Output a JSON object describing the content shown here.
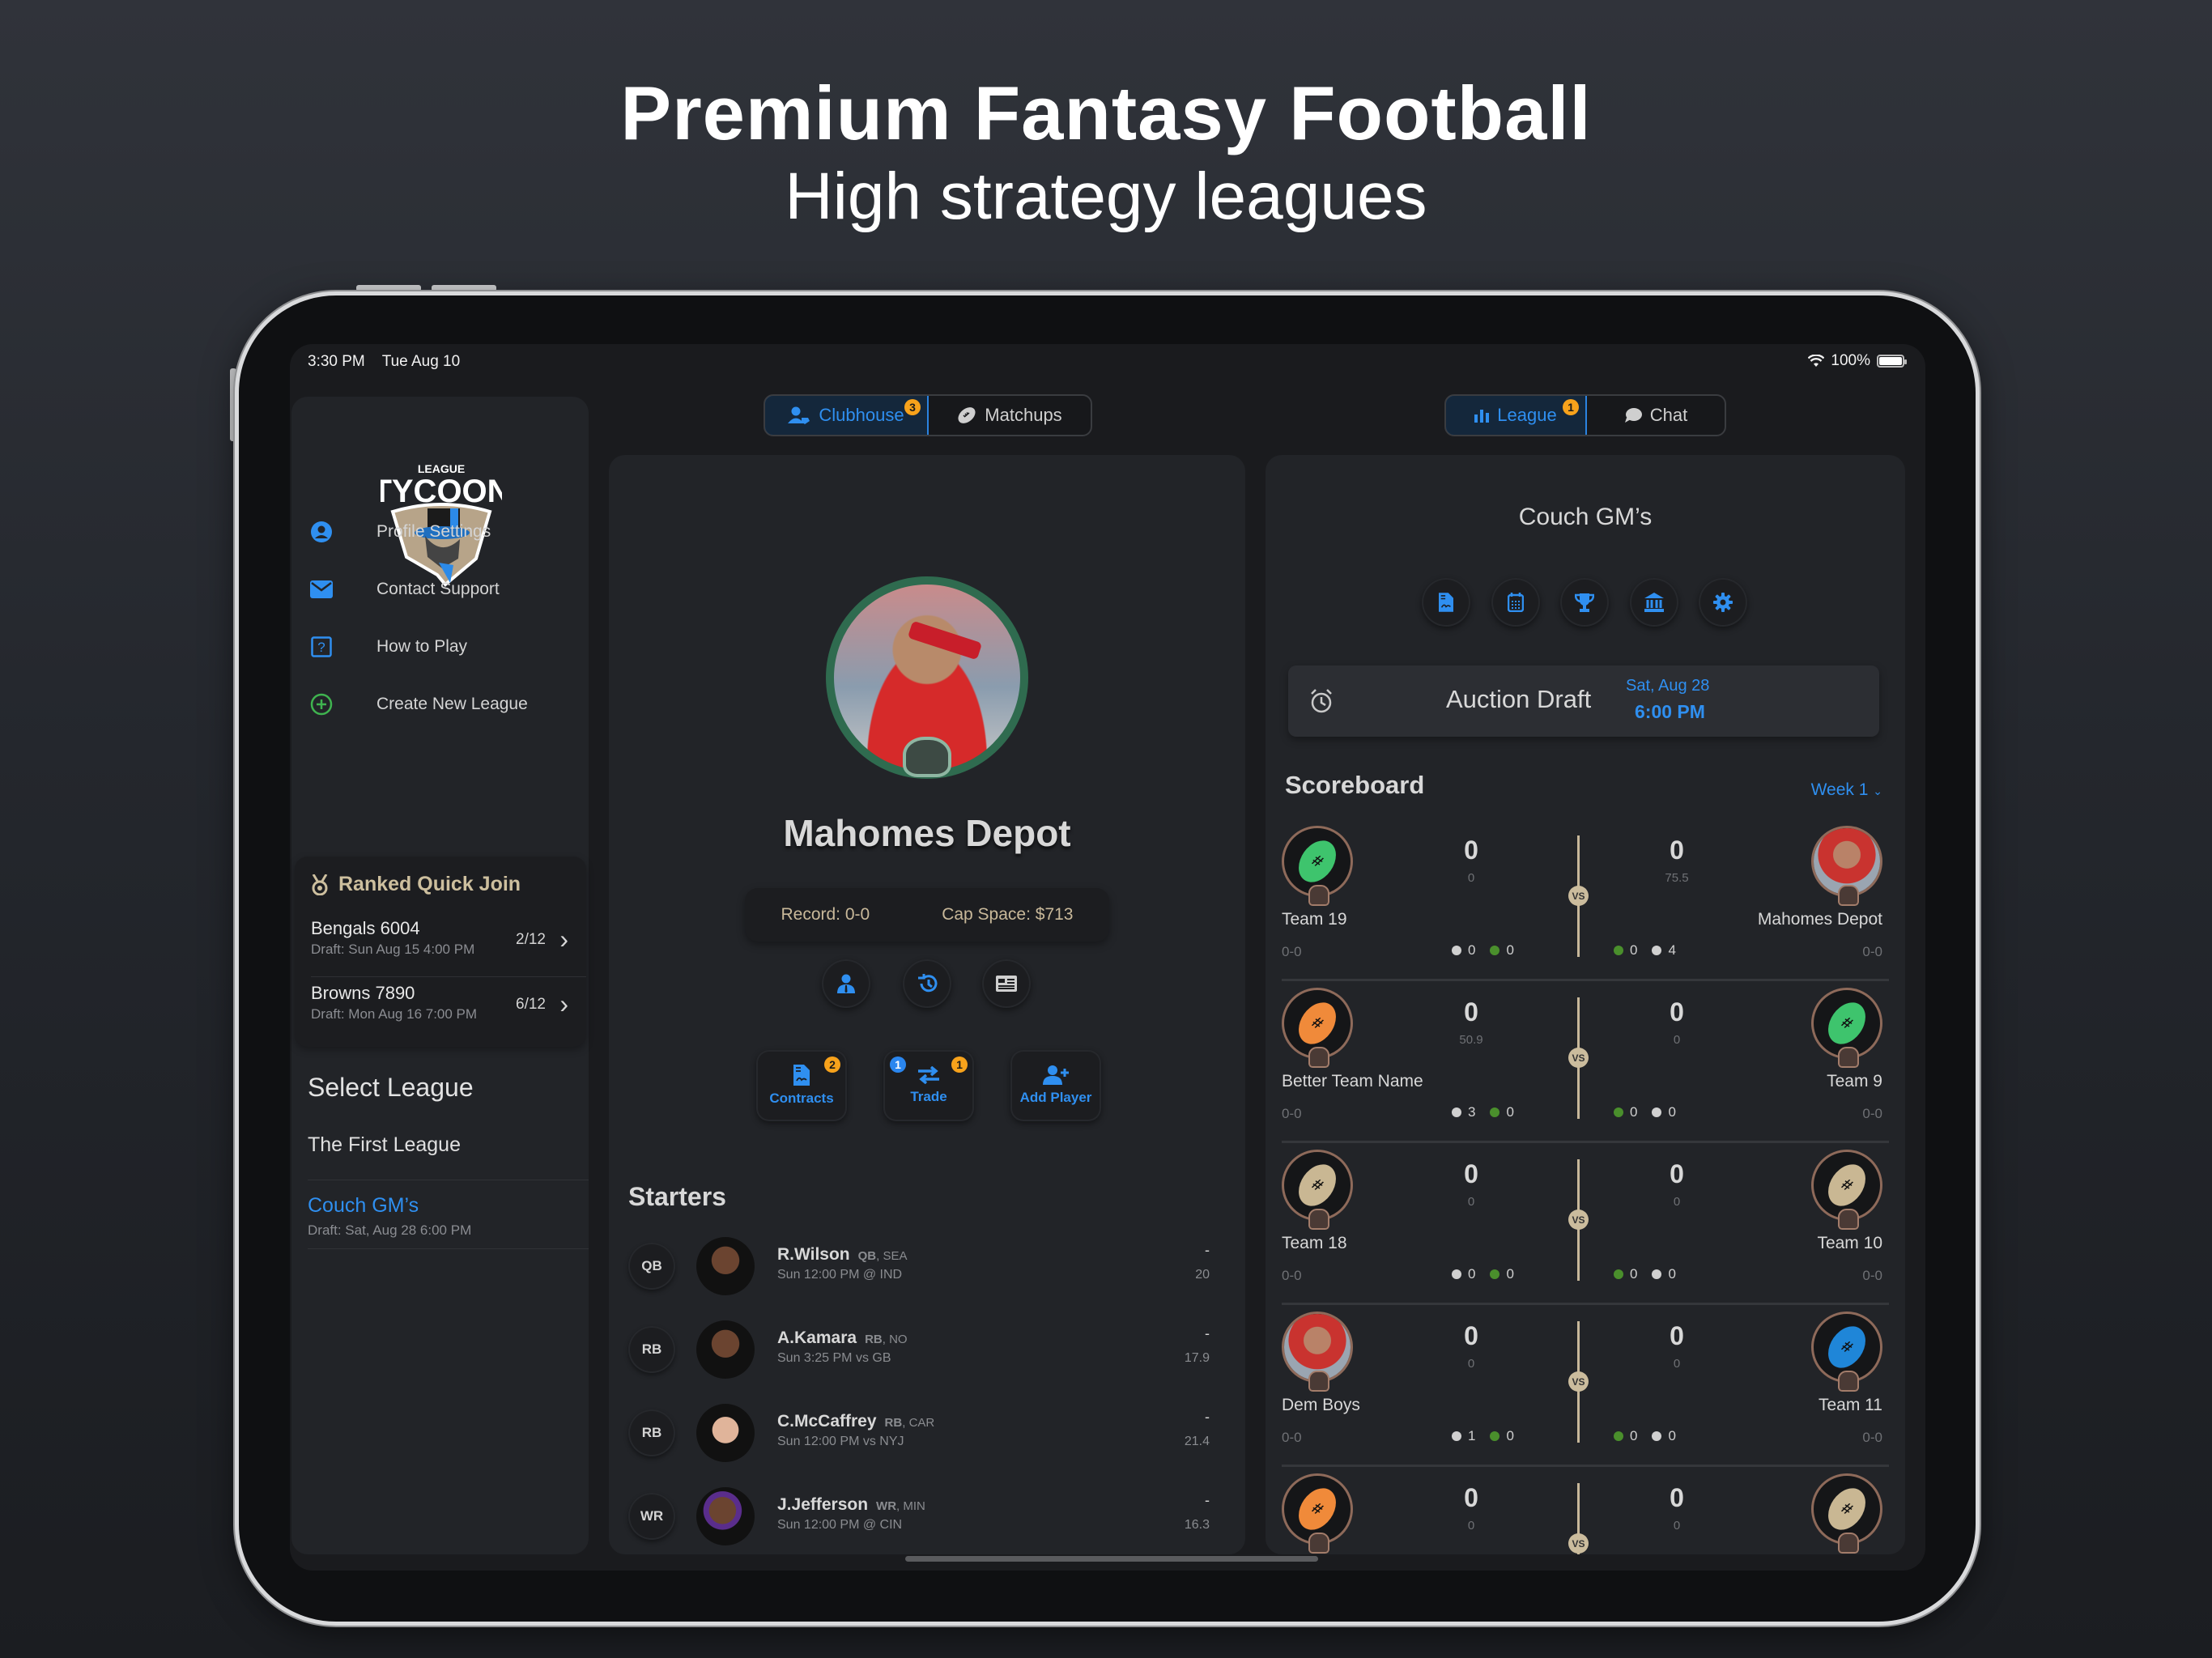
{
  "hero": {
    "title": "Premium Fantasy Football",
    "subtitle": "High strategy leagues"
  },
  "status_bar": {
    "time": "3:30 PM",
    "date": "Tue Aug 10",
    "battery": "100%",
    "icons": [
      "wifi-icon",
      "battery-icon"
    ]
  },
  "sidebar": {
    "logo": {
      "top_text": "LEAGUE",
      "main_text": "TYCOON"
    },
    "menu": [
      {
        "label": "Profile Settings",
        "icon": "person-circle-icon"
      },
      {
        "label": "Contact Support",
        "icon": "envelope-icon"
      },
      {
        "label": "How to Play",
        "icon": "question-square-icon"
      },
      {
        "label": "Create New League",
        "icon": "plus-circle-icon"
      }
    ],
    "ranked_quick_join": {
      "title": "Ranked Quick Join",
      "icon": "medal-icon",
      "items": [
        {
          "name": "Bengals 6004",
          "draft": "Draft: Sun Aug 15  4:00 PM",
          "count": "2/12"
        },
        {
          "name": "Browns 7890",
          "draft": "Draft: Mon Aug 16  7:00 PM",
          "count": "6/12"
        }
      ]
    },
    "select_league": {
      "title": "Select League",
      "leagues": [
        {
          "name": "The First League",
          "draft": "",
          "selected": false
        },
        {
          "name": "Couch GM’s",
          "draft": "Draft: Sat, Aug 28  6:00 PM",
          "selected": true
        }
      ]
    }
  },
  "center_tabs": {
    "tabs": [
      {
        "label": "Clubhouse",
        "icon": "people-icon",
        "badge": "3",
        "active": true
      },
      {
        "label": "Matchups",
        "icon": "football-icon",
        "badge": "",
        "active": false
      }
    ]
  },
  "right_tabs": {
    "tabs": [
      {
        "label": "League",
        "icon": "bar-chart-icon",
        "badge": "1",
        "active": true
      },
      {
        "label": "Chat",
        "icon": "chat-bubble-icon",
        "badge": "",
        "active": false
      }
    ]
  },
  "clubhouse": {
    "team_name": "Mahomes Depot",
    "record": "Record: 0-0",
    "cap_space": "Cap Space: $713",
    "circle_actions": [
      "manager-icon",
      "history-icon",
      "news-icon"
    ],
    "actions": [
      {
        "label": "Contracts",
        "icon": "contract-icon",
        "badge_right": "2",
        "badge_left": ""
      },
      {
        "label": "Trade",
        "icon": "trade-arrows-icon",
        "badge_right": "1",
        "badge_left": "1"
      },
      {
        "label": "Add Player",
        "icon": "add-person-icon",
        "badge_right": "",
        "badge_left": ""
      }
    ],
    "starters_title": "Starters",
    "starters": [
      {
        "slot": "QB",
        "name": "R.Wilson",
        "pos": "QB",
        "team": "SEA",
        "game": "Sun 12:00 PM @ IND",
        "score": "-",
        "proj": "20"
      },
      {
        "slot": "RB",
        "name": "A.Kamara",
        "pos": "RB",
        "team": "NO",
        "game": "Sun 3:25 PM vs GB",
        "score": "-",
        "proj": "17.9"
      },
      {
        "slot": "RB",
        "name": "C.McCaffrey",
        "pos": "RB",
        "team": "CAR",
        "game": "Sun 12:00 PM vs NYJ",
        "score": "-",
        "proj": "21.4"
      },
      {
        "slot": "WR",
        "name": "J.Jefferson",
        "pos": "WR",
        "team": "MIN",
        "game": "Sun 12:00 PM @ CIN",
        "score": "-",
        "proj": "16.3"
      }
    ]
  },
  "league": {
    "title": "Couch GM’s",
    "icons": [
      "contract-icon",
      "calendar-icon",
      "trophy-icon",
      "bank-icon",
      "gear-icon"
    ],
    "draft": {
      "label": "Auction Draft",
      "date": "Sat, Aug 28",
      "time": "6:00 PM",
      "icon": "alarm-clock-icon"
    },
    "scoreboard_title": "Scoreboard",
    "week": "Week 1",
    "vs_label": "VS",
    "matchups": [
      {
        "left": {
          "name": "Team 19",
          "record": "0-0",
          "score": "0",
          "proj": "0",
          "stat_gray": "0",
          "stat_green": "0",
          "avatar": "football-green"
        },
        "right": {
          "name": "Mahomes Depot",
          "record": "0-0",
          "score": "0",
          "proj": "75.5",
          "stat_gray": "4",
          "stat_green": "0",
          "avatar": "photo"
        }
      },
      {
        "left": {
          "name": "Better Team Name",
          "record": "0-0",
          "score": "0",
          "proj": "50.9",
          "stat_gray": "3",
          "stat_green": "0",
          "avatar": "football-orange"
        },
        "right": {
          "name": "Team 9",
          "record": "0-0",
          "score": "0",
          "proj": "0",
          "stat_gray": "0",
          "stat_green": "0",
          "avatar": "football-green"
        }
      },
      {
        "left": {
          "name": "Team 18",
          "record": "0-0",
          "score": "0",
          "proj": "0",
          "stat_gray": "0",
          "stat_green": "0",
          "avatar": "football-tan"
        },
        "right": {
          "name": "Team 10",
          "record": "0-0",
          "score": "0",
          "proj": "0",
          "stat_gray": "0",
          "stat_green": "0",
          "avatar": "football-tan"
        }
      },
      {
        "left": {
          "name": "Dem Boys",
          "record": "0-0",
          "score": "0",
          "proj": "0",
          "stat_gray": "1",
          "stat_green": "0",
          "avatar": "photo"
        },
        "right": {
          "name": "Team 11",
          "record": "0-0",
          "score": "0",
          "proj": "0",
          "stat_gray": "0",
          "stat_green": "0",
          "avatar": "football-blue"
        }
      },
      {
        "left": {
          "name": "",
          "record": "",
          "score": "0",
          "proj": "0",
          "stat_gray": "",
          "stat_green": "",
          "avatar": "football-orange"
        },
        "right": {
          "name": "",
          "record": "",
          "score": "0",
          "proj": "0",
          "stat_gray": "",
          "stat_green": "",
          "avatar": "football-tan"
        }
      }
    ]
  },
  "colors": {
    "accent_blue": "#2f8ff0",
    "badge_orange": "#f7a21b",
    "gold_text": "#c9b99a",
    "green_dot": "#4a8f2c",
    "gray_dot": "#d0d0d0",
    "ball_green": "#3ec46d",
    "ball_orange": "#f08a3a",
    "ball_tan": "#c9b793",
    "ball_blue": "#1f86d8"
  }
}
